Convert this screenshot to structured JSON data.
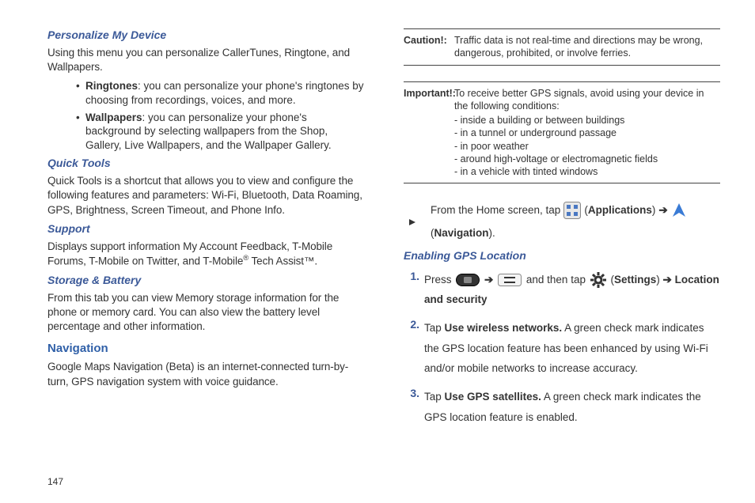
{
  "left": {
    "pmd_title": "Personalize My Device",
    "pmd_body": "Using this menu you can personalize CallerTunes, Ringtone, and Wallpapers.",
    "ringtones_label": "Ringtones",
    "ringtones_text": ": you can personalize your phone's ringtones by choosing from recordings, voices, and more.",
    "wallpapers_label": "Wallpapers",
    "wallpapers_text": ": you can personalize your phone's background by selecting wallpapers from the Shop, Gallery, Live Wallpapers, and the Wallpaper Gallery.",
    "qt_title": "Quick Tools",
    "qt_body": "Quick Tools is a shortcut that allows you to view and configure the following features and parameters: Wi-Fi, Bluetooth, Data Roaming, GPS, Brightness, Screen Timeout, and Phone Info.",
    "sup_title": "Support",
    "sup_body_a": "Displays support information My Account Feedback, T-Mobile Forums, T-Mobile on Twitter, and T-Mobile",
    "sup_reg": "®",
    "sup_body_b": " Tech Assist™.",
    "sb_title": "Storage & Battery",
    "sb_body": "From this tab you can view Memory storage information for the phone or memory card. You can also view the battery level percentage and other information.",
    "nav_title": "Navigation",
    "nav_body": "Google Maps Navigation (Beta) is an internet-connected turn-by-turn, GPS navigation system with voice guidance."
  },
  "right": {
    "caution_label": "Caution!:",
    "caution_body": "Traffic data is not real-time and directions may be wrong, dangerous, prohibited, or involve ferries.",
    "important_label": "Important!:",
    "important_body": "To receive better GPS signals, avoid using your device in the following conditions:",
    "important_items": [
      "- inside a building or between buildings",
      "- in a tunnel or underground passage",
      "- in poor weather",
      "- around high-voltage or electromagnetic fields",
      "- in a vehicle with tinted windows"
    ],
    "home_a": "From the Home screen, tap",
    "applications": "Applications",
    "navigation": "Navigation",
    "egl_title": "Enabling GPS Location",
    "step1_num": "1.",
    "step1_a": "Press",
    "step1_b": "and then tap",
    "settings": "Settings",
    "step1_c": "Location and security",
    "step2_num": "2.",
    "step2_a": "Tap ",
    "step2_bold": "Use wireless networks.",
    "step2_b": " A green check mark indicates the GPS location feature has been enhanced by using Wi-Fi and/or mobile networks to increase accuracy.",
    "step3_num": "3.",
    "step3_a": "Tap ",
    "step3_bold": "Use GPS satellites.",
    "step3_b": " A green check mark indicates the GPS location feature is enabled."
  },
  "page_num": "147",
  "glyphs": {
    "arrow": "➔"
  }
}
